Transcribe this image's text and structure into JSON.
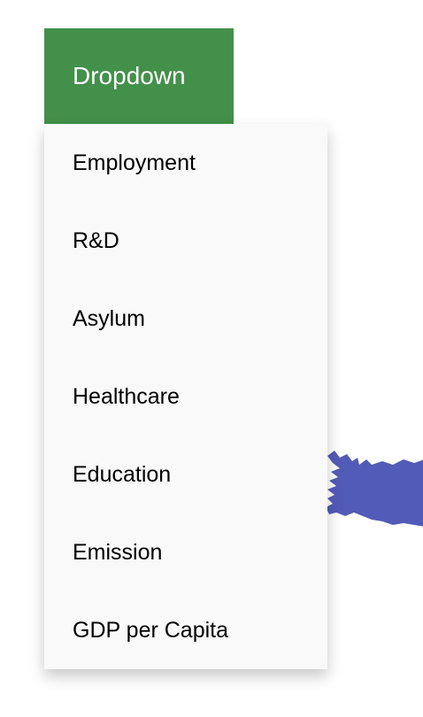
{
  "dropdown": {
    "button_label": "Dropdown",
    "button_color": "#43904a",
    "items": [
      {
        "label": "Employment"
      },
      {
        "label": "R&D"
      },
      {
        "label": "Asylum"
      },
      {
        "label": "Healthcare"
      },
      {
        "label": "Education"
      },
      {
        "label": "Emission"
      },
      {
        "label": "GDP per Capita"
      }
    ]
  },
  "map": {
    "region_color": "#535bb8",
    "icon": "country-shape-icon"
  }
}
